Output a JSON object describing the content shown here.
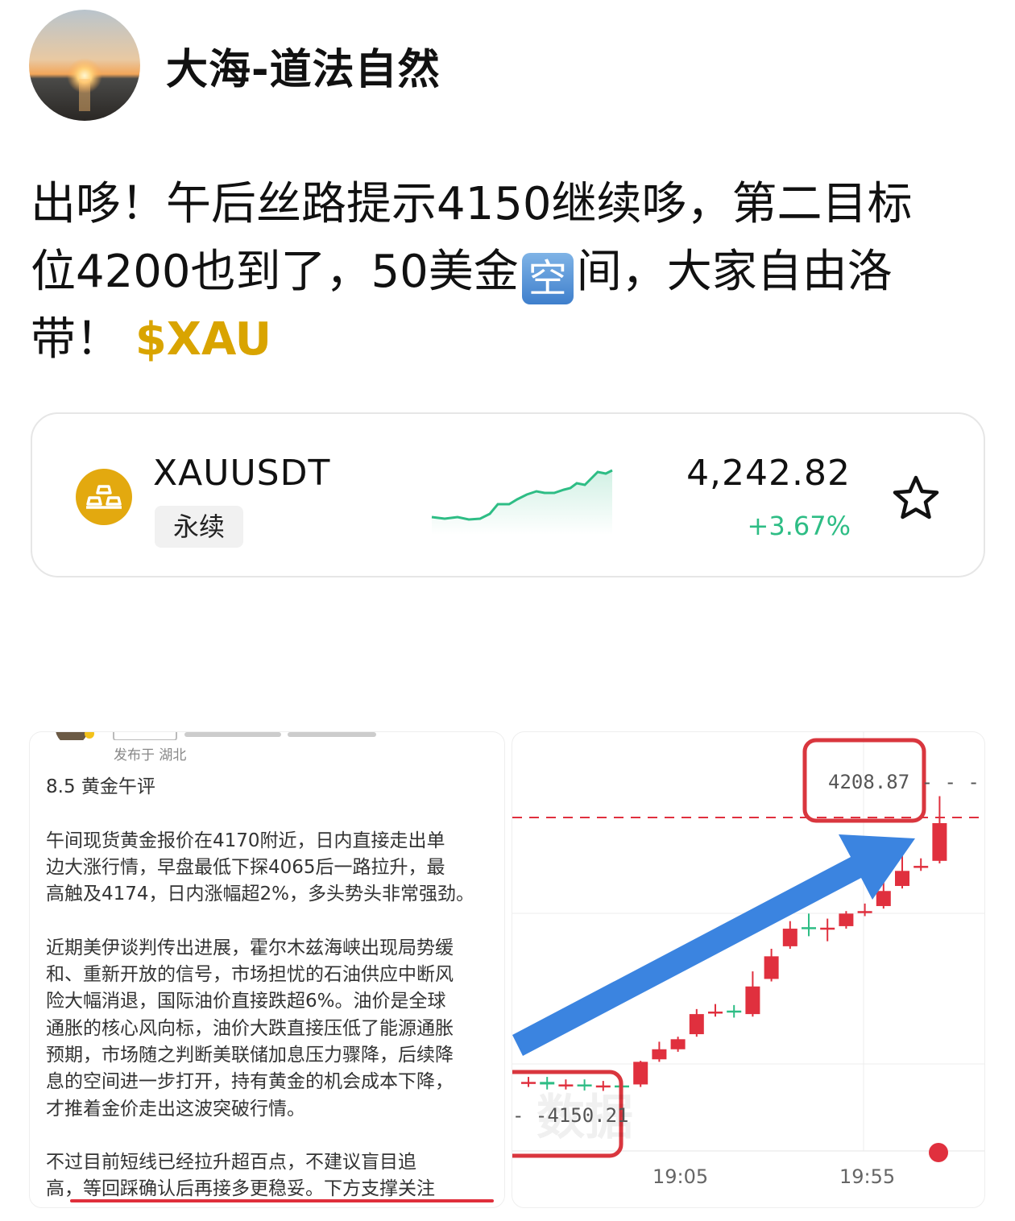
{
  "author": {
    "name": "大海-道法自然"
  },
  "post": {
    "line1": "出哆！午后丝路提示4150继续哆，第二目标",
    "line2a": "位4200也到了，50美金",
    "kong_emoji": "空",
    "line2b": "间，大家自由洛",
    "line3": "带！",
    "cashtag": "$XAU"
  },
  "ticker": {
    "symbol": "XAUUSDT",
    "tag": "永续",
    "price": "4,242.82",
    "change": "+3.67%",
    "icons": {
      "coin": "gold-bars-icon",
      "star": "star-outline-icon"
    },
    "colors": {
      "up": "#2ebd85",
      "coin": "#e3a90f"
    }
  },
  "article": {
    "location": "发布于 湖北",
    "title": "8.5 黄金午评",
    "p1_l1": "午间现货黄金报价在4170附近，日内直接走出单",
    "p1_l2": "边大涨行情，早盘最低下探4065后一路拉升，最",
    "p1_l3": "高触及4174，日内涨幅超2%，多头势头非常强劲。",
    "p2_l1": "近期美伊谈判传出进展，霍尔木兹海峡出现局势缓",
    "p2_l2": "和、重新开放的信号，市场担忧的石油供应中断风",
    "p2_l3": "险大幅消退，国际油价直接跌超6%。油价是全球",
    "p2_l4": "通胀的核心风向标，油价大跌直接压低了能源通胀",
    "p2_l5": "预期，市场随之判断美联储加息压力骤降，后续降",
    "p2_l6": "息的空间进一步打开，持有黄金的机会成本下降，",
    "p2_l7": "才推着金价走出这波突破行情。",
    "p3_l1": "不过目前短线已经拉升超百点，不建议盲目追",
    "p3_l2": "高，等回踩确认后再接多更稳妥。下方支撑关注"
  },
  "kline": {
    "high_label": "4208.87",
    "low_label": "4150.21",
    "time_labels": [
      "19:05",
      "19:55"
    ],
    "watermark": "数据",
    "colors": {
      "up": "#e0303e",
      "down": "#2ebd85",
      "arrow": "#3b84e0",
      "box": "#d9363e"
    }
  },
  "chart_data": {
    "type": "candlestick",
    "title": "",
    "x_ticks": [
      "19:05",
      "19:55"
    ],
    "marked_high": 4208.87,
    "marked_low": 4150.21,
    "candles": [
      {
        "o": 4152,
        "c": 4152,
        "h": 4153,
        "l": 4151
      },
      {
        "o": 4152,
        "c": 4151.5,
        "h": 4153,
        "l": 4150.5
      },
      {
        "o": 4151.5,
        "c": 4151.5,
        "h": 4152.5,
        "l": 4150.5
      },
      {
        "o": 4151.5,
        "c": 4151.3,
        "h": 4152.5,
        "l": 4150.3
      },
      {
        "o": 4151.3,
        "c": 4151.3,
        "h": 4152.2,
        "l": 4150.21
      },
      {
        "o": 4151.3,
        "c": 4151.1,
        "h": 4152.0,
        "l": 4150.5
      },
      {
        "o": 4151.5,
        "c": 4156.0,
        "h": 4156.2,
        "l": 4151.0
      },
      {
        "o": 4156.5,
        "c": 4158.5,
        "h": 4160.0,
        "l": 4156.0
      },
      {
        "o": 4158.5,
        "c": 4160.5,
        "h": 4161.0,
        "l": 4158.0
      },
      {
        "o": 4161.5,
        "c": 4165.5,
        "h": 4166.5,
        "l": 4161.0
      },
      {
        "o": 4166.0,
        "c": 4166.0,
        "h": 4167.5,
        "l": 4165.0
      },
      {
        "o": 4166.2,
        "c": 4165.8,
        "h": 4167.3,
        "l": 4164.8
      },
      {
        "o": 4165.5,
        "c": 4171.0,
        "h": 4174.0,
        "l": 4165.0
      },
      {
        "o": 4172.5,
        "c": 4177.0,
        "h": 4178.5,
        "l": 4172.0
      },
      {
        "o": 4179.0,
        "c": 4182.5,
        "h": 4184.0,
        "l": 4178.5
      },
      {
        "o": 4182.8,
        "c": 4182.5,
        "h": 4185.5,
        "l": 4181.0
      },
      {
        "o": 4182.5,
        "c": 4182.7,
        "h": 4184.5,
        "l": 4180.0
      },
      {
        "o": 4183.0,
        "c": 4185.5,
        "h": 4186.0,
        "l": 4182.5
      },
      {
        "o": 4186.0,
        "c": 4186.0,
        "h": 4187.5,
        "l": 4185.0
      },
      {
        "o": 4187.0,
        "c": 4190.0,
        "h": 4193.0,
        "l": 4186.5
      },
      {
        "o": 4191.0,
        "c": 4194.0,
        "h": 4198.0,
        "l": 4190.5
      },
      {
        "o": 4195.0,
        "c": 4195.0,
        "h": 4196.5,
        "l": 4194.0
      },
      {
        "o": 4196.0,
        "c": 4203.5,
        "h": 4208.87,
        "l": 4195.5
      }
    ]
  }
}
